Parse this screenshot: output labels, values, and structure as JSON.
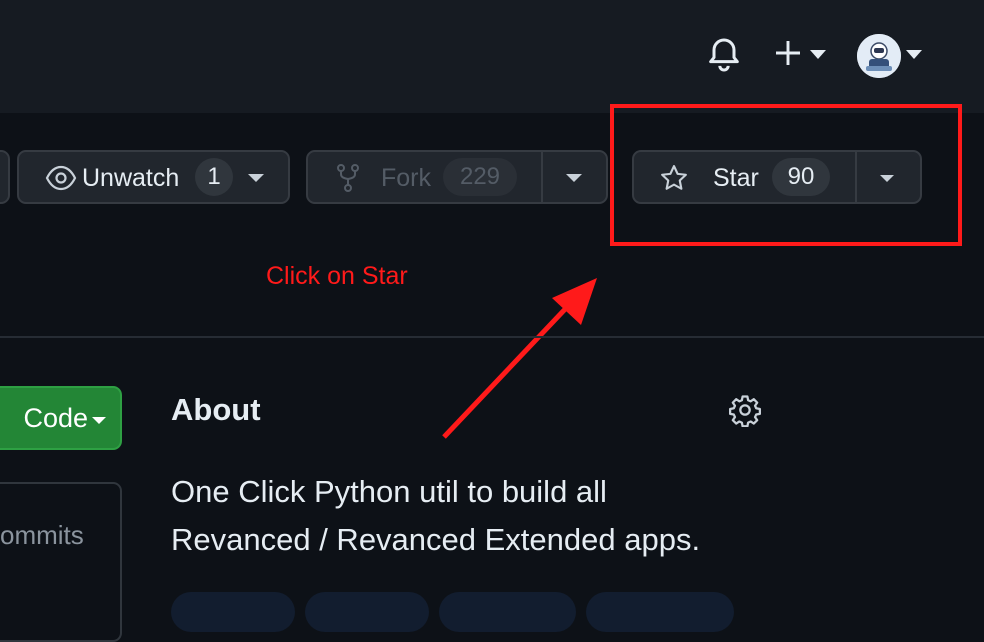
{
  "header": {
    "icons": [
      "bell-icon",
      "plus-icon",
      "chevron-down-icon",
      "avatar"
    ]
  },
  "repo_actions": {
    "unwatch": {
      "label": "Unwatch",
      "count": "1"
    },
    "fork": {
      "label": "Fork",
      "count": "229"
    },
    "star": {
      "label": "Star",
      "count": "90"
    }
  },
  "annotation": {
    "text": "Click on Star",
    "color": "#ff1a1a"
  },
  "code_button": {
    "label": "Code"
  },
  "commits": {
    "label": "ommits"
  },
  "about": {
    "title": "About",
    "description_line1": "One Click Python util to build all",
    "description_line2": "Revanced / Revanced Extended apps."
  },
  "colors": {
    "background": "#0d1117",
    "header": "#161b22",
    "button": "#21262d",
    "code_green": "#238636",
    "text": "#e6edf3"
  }
}
